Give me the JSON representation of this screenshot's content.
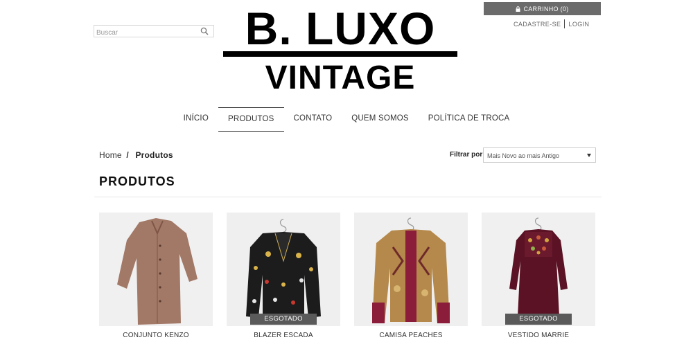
{
  "search": {
    "placeholder": "Buscar"
  },
  "logo": {
    "line1": "B. LUXO",
    "line2": "VINTAGE"
  },
  "cart": {
    "label": "CARRINHO (0)"
  },
  "account": {
    "register": "CADASTRE-SE",
    "login": "LOGIN"
  },
  "nav": {
    "items": [
      {
        "label": "INÍCIO"
      },
      {
        "label": "PRODUTOS"
      },
      {
        "label": "CONTATO"
      },
      {
        "label": "QUEM SOMOS"
      },
      {
        "label": "POLÍTICA DE TROCA"
      }
    ]
  },
  "breadcrumb": {
    "home": "Home",
    "separator": "/",
    "current": "Produtos"
  },
  "filter": {
    "label": "Filtrar por",
    "selected": "Mais Novo ao mais Antigo"
  },
  "page_title": "PRODUTOS",
  "products": [
    {
      "name": "CONJUNTO KENZO",
      "badge": ""
    },
    {
      "name": "BLAZER ESCADA",
      "badge": "ESGOTADO"
    },
    {
      "name": "CAMISA PEACHES",
      "badge": ""
    },
    {
      "name": "VESTIDO MARRIE",
      "badge": "ESGOTADO"
    }
  ],
  "colors": {
    "cart_bg": "#6b6b6b",
    "badge_bg": "#5a5a5a"
  }
}
